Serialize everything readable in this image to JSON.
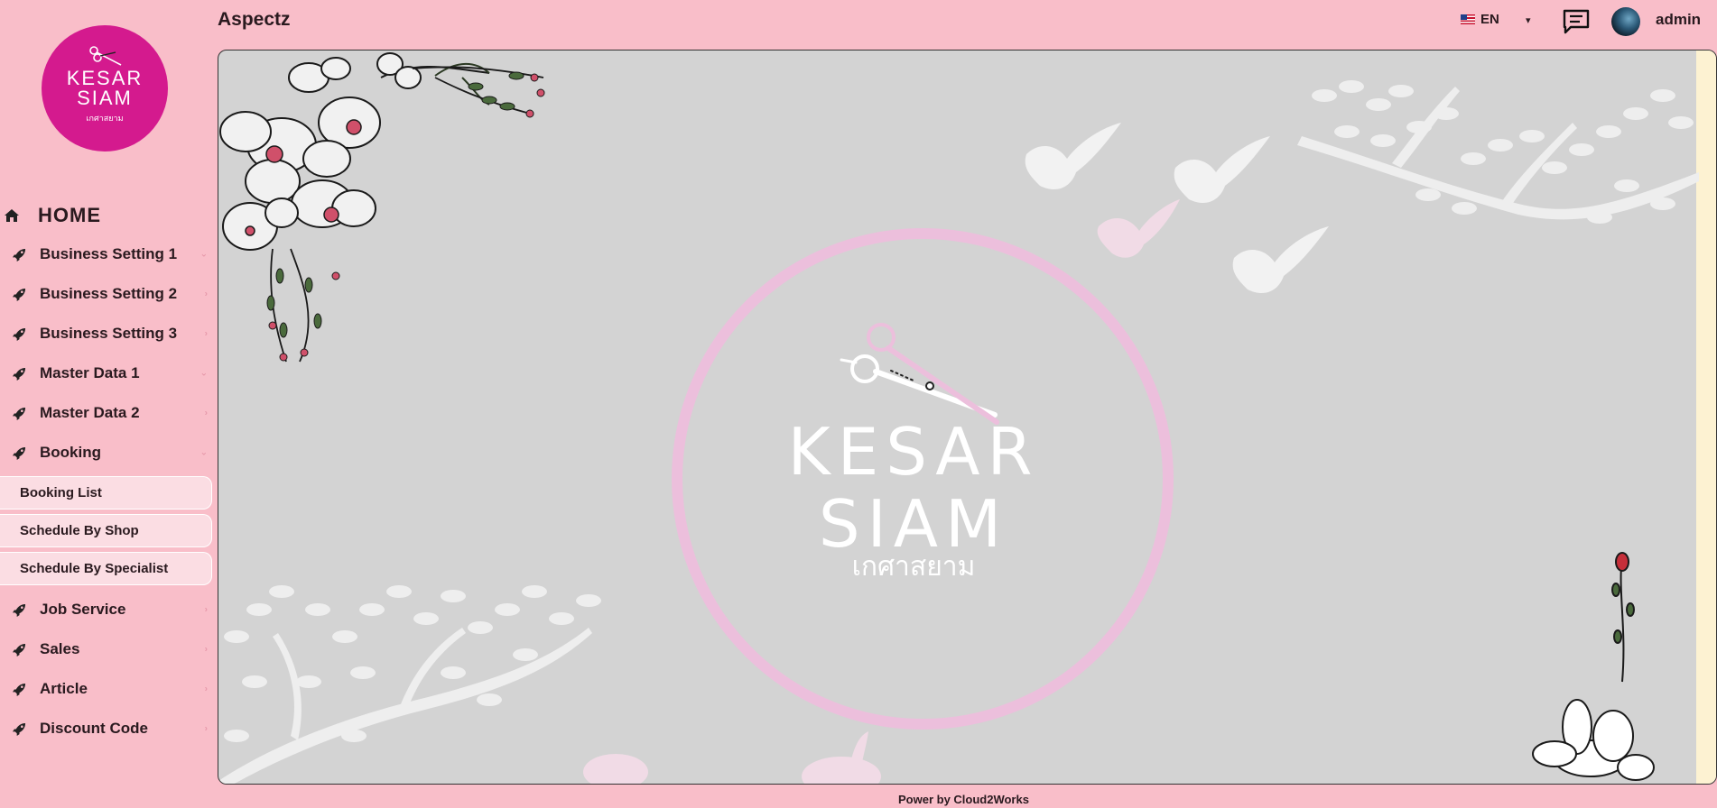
{
  "app": {
    "title": "Aspectz",
    "logo": {
      "line1": "KESAR",
      "line2": "SIAM",
      "thai": "เกศาสยาม",
      "color": "#d41a8e"
    }
  },
  "header": {
    "language": "EN",
    "user_name": "admin",
    "icons": [
      "us-flag-icon",
      "caret-down-icon",
      "chat-icon",
      "avatar"
    ]
  },
  "sidebar": {
    "home_label": "HOME",
    "items": [
      {
        "label": "Business Setting 1",
        "icon": "rocket-icon"
      },
      {
        "label": "Business Setting 2",
        "icon": "rocket-icon"
      },
      {
        "label": "Business Setting 3",
        "icon": "rocket-icon"
      },
      {
        "label": "Master Data 1",
        "icon": "rocket-icon"
      },
      {
        "label": "Master Data 2",
        "icon": "rocket-icon"
      },
      {
        "label": "Booking",
        "icon": "rocket-icon",
        "expanded": true
      },
      {
        "label": "Job Service",
        "icon": "rocket-icon"
      },
      {
        "label": "Sales",
        "icon": "rocket-icon"
      },
      {
        "label": "Article",
        "icon": "rocket-icon"
      },
      {
        "label": "Discount Code",
        "icon": "rocket-icon"
      }
    ],
    "booking_sub": [
      {
        "label": "Booking List"
      },
      {
        "label": "Schedule By Shop"
      },
      {
        "label": "Schedule By Specialist"
      }
    ]
  },
  "hero": {
    "line1": "KESAR",
    "line2": "SIAM",
    "thai": "เกศาสยาม",
    "ring_color": "#ecbfdc",
    "background": "#d3d3d3"
  },
  "footer": {
    "text": "Power by Cloud2Works"
  },
  "colors": {
    "page_bg": "#f9bec9",
    "submenu_bg": "#fbdde3",
    "accent": "#d41a8e"
  }
}
